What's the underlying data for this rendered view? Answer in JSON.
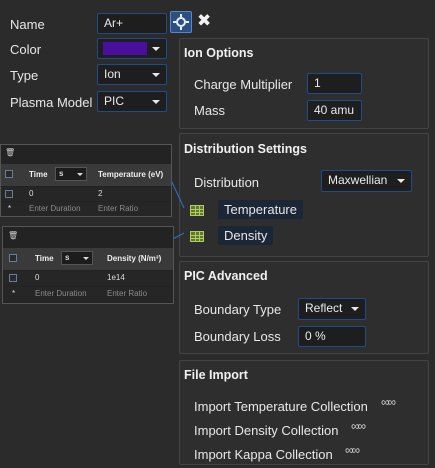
{
  "props": {
    "name_label": "Name",
    "name_value": "Ar+",
    "color_label": "Color",
    "color_value": "#4b0fa0",
    "type_label": "Type",
    "type_value": "Ion",
    "plasma_label": "Plasma Model",
    "plasma_value": "PIC"
  },
  "ion_options": {
    "title": "Ion Options",
    "charge_label": "Charge Multiplier",
    "charge_value": "1",
    "mass_label": "Mass",
    "mass_value": "40 amu"
  },
  "distribution": {
    "title": "Distribution Settings",
    "dist_label": "Distribution",
    "dist_value": "Maxwellian",
    "temperature_label": "Temperature",
    "density_label": "Density"
  },
  "pic": {
    "title": "PIC Advanced",
    "boundary_type_label": "Boundary Type",
    "boundary_type_value": "Reflect",
    "boundary_loss_label": "Boundary Loss",
    "boundary_loss_value": "0 %"
  },
  "file_import": {
    "title": "File Import",
    "items": [
      "Import Temperature Collection",
      "Import Density Collection",
      "Import Kappa Collection"
    ]
  },
  "table_temperature": {
    "col_time": "Time",
    "unit": "s",
    "col_value": "Temperature (eV)",
    "row_time": "0",
    "row_value": "2",
    "new_marker": "*",
    "new_time": "Enter Duration",
    "new_value": "Enter Ratio"
  },
  "table_density": {
    "col_time": "Time",
    "unit": "s",
    "col_value": "Density (N/m³)",
    "row_time": "0",
    "row_value": "1e14",
    "new_marker": "*",
    "new_time": "Enter Duration",
    "new_value": "Enter Ratio"
  },
  "icons": {
    "close": "✖",
    "link": "∞∞",
    "trash": "🗑"
  },
  "colors": {
    "accent_border": "#1f4c88",
    "chip_bg": "#1b2636",
    "grid_icon": "#5c7a2a"
  }
}
